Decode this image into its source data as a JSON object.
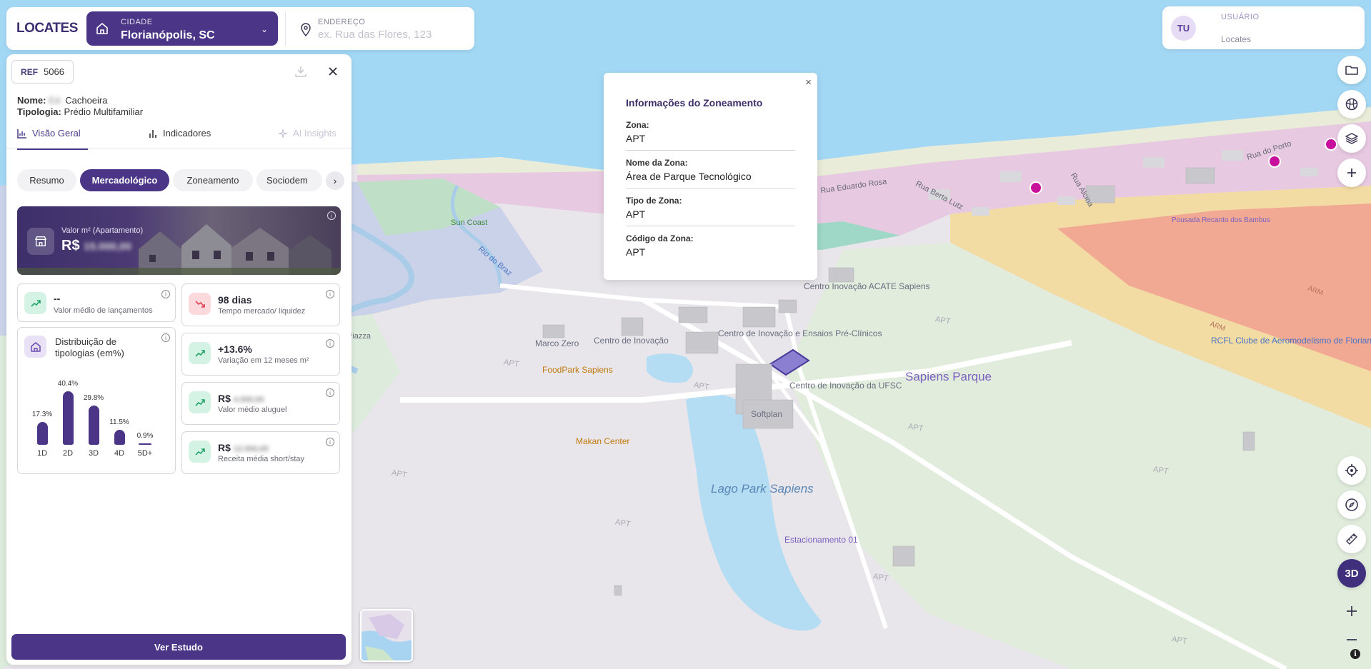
{
  "app": {
    "logo": "LOCATES"
  },
  "search": {
    "city_label": "CIDADE",
    "city_value": "Florianópolis, SC",
    "address_label": "ENDEREÇO",
    "address_placeholder": "ex. Rua das Flores, 123"
  },
  "user": {
    "initials": "TU",
    "label": "USUÁRIO",
    "name": "Locates"
  },
  "panel": {
    "ref_label": "REF",
    "ref_value": "5066",
    "name_label": "Nome:",
    "name_hidden": "Ed.",
    "name_value": "Cachoeira",
    "tipologia_label": "Tipologia:",
    "tipologia_value": "Prédio Multifamiliar",
    "view_tabs": [
      "Visão Geral",
      "Indicadores",
      "AI Insights"
    ],
    "pill_tabs": [
      "Resumo",
      "Mercadológico",
      "Zoneamento",
      "Sociodem"
    ],
    "active_pill": "Mercadológico",
    "hero": {
      "label": "Valor m² (Apartamento)",
      "currency": "R$",
      "hidden_value": "15.000,00"
    },
    "cards": {
      "lancamentos": {
        "title": "--",
        "sub": "Valor médio de lançamentos"
      },
      "tempo": {
        "title": "98 dias",
        "sub": "Tempo mercado/ liquidez"
      },
      "variacao": {
        "title": "+13.6%",
        "sub": "Variação em 12 meses m²"
      },
      "aluguel": {
        "currency": "R$",
        "hidden": "4.000,00",
        "sub": "Valor médio aluguel"
      },
      "short": {
        "currency": "R$",
        "hidden": "12.000,00",
        "sub": "Receita média short/stay"
      }
    },
    "distribution": {
      "title": "Distribuição de tipologias (em%)",
      "categories": [
        "1D",
        "2D",
        "3D",
        "4D",
        "5D+"
      ],
      "values_pct": [
        17.3,
        40.4,
        29.8,
        11.5,
        0.9
      ],
      "labels": [
        "17.3%",
        "40.4%",
        "29.8%",
        "11.5%",
        "0.9%"
      ]
    },
    "cta": "Ver Estudo"
  },
  "zone_popup": {
    "close": "×",
    "title": "Informações do Zoneamento",
    "rows": [
      {
        "k": "Zona:",
        "v": "APT"
      },
      {
        "k": "Nome da Zona:",
        "v": "Área de Parque Tecnológico"
      },
      {
        "k": "Tipo de Zona:",
        "v": "APT"
      },
      {
        "k": "Código da Zona:",
        "v": "APT"
      }
    ]
  },
  "map": {
    "labels": {
      "sapiens": "Sapiens Parque",
      "lake": "Lago Park Sapiens",
      "estacionamento": "Estacionamento 01",
      "makan": "Makan Center",
      "foodpark": "FoodPark Sapiens",
      "marco": "Marco Zero",
      "centro_inovacao": "Centro de Inovação",
      "centro_pre": "Centro de Inovação e Ensaios Pré-Clínicos",
      "centro_acate": "Centro Inovação ACATE Sapiens",
      "centro_ufsc": "Centro de Inovação da UFSC",
      "softplan": "Softplan",
      "sun_coast": "Sun Coast",
      "rio_do_braz": "Rio do Braz",
      "rcfl": "RCFL Clube de Aeromodelismo de Florianópolis",
      "rua_eduardo": "Rua Eduardo Rosa",
      "rua_berta": "Rua Berta Lutz",
      "rua_alcina": "Rua Alcina",
      "rua_porto": "Rua do Porto",
      "pousada": "Pousada Recanto dos Bambus",
      "piazza": "Piazza",
      "apt": "APT",
      "armacao": "ARM"
    }
  }
}
